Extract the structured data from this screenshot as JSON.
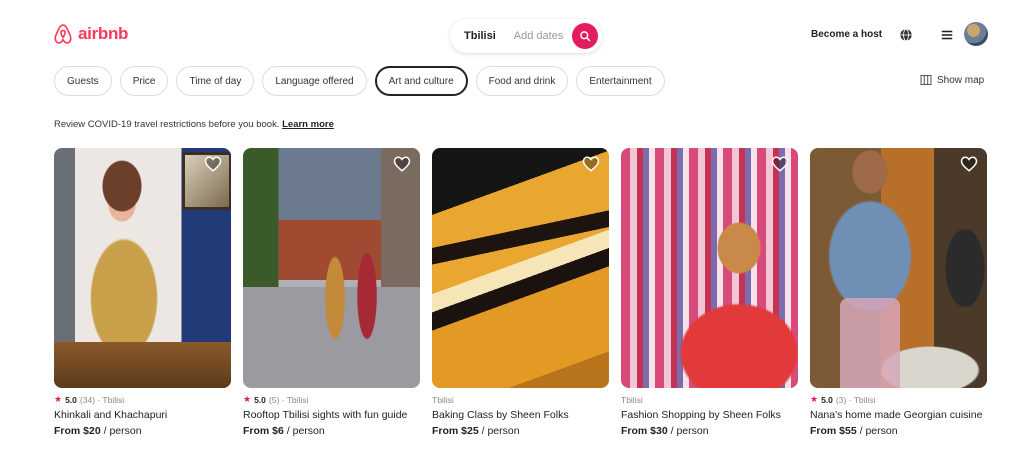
{
  "header": {
    "logo_text": "airbnb",
    "search": {
      "location": "Tbilisi",
      "guests": "Add dates"
    },
    "host_link": "Become a host"
  },
  "filters": {
    "chips": [
      {
        "label": "Guests",
        "active": false
      },
      {
        "label": "Price",
        "active": false
      },
      {
        "label": "Time of day",
        "active": false
      },
      {
        "label": "Language offered",
        "active": false
      },
      {
        "label": "Art and culture",
        "active": true
      },
      {
        "label": "Food and drink",
        "active": false
      },
      {
        "label": "Entertainment",
        "active": false
      }
    ],
    "show_map": "Show map"
  },
  "notice": {
    "text": "Review COVID-19 travel restrictions before you book.",
    "link": "Learn more"
  },
  "cards": [
    {
      "rating": "5.0",
      "meta": "(34) · Tbilisi",
      "title": "Khinkali and Khachapuri",
      "price": "From $20",
      "unit": " / person"
    },
    {
      "rating": "5.0",
      "meta": "(5) · Tbilisi",
      "title": "Rooftop Tbilisi sights with fun guide",
      "price": "From $6",
      "unit": " / person"
    },
    {
      "rating": "",
      "meta": "Tbilisi",
      "title": "Baking Class by Sheen Folks",
      "price": "From $25",
      "unit": " / person"
    },
    {
      "rating": "",
      "meta": "Tbilisi",
      "title": "Fashion Shopping by Sheen Folks",
      "price": "From $30",
      "unit": " / person"
    },
    {
      "rating": "5.0",
      "meta": "(3) · Tbilisi",
      "title": "Nana's home made Georgian cuisine",
      "price": "From $55",
      "unit": " / person"
    }
  ],
  "colors": {
    "brand": "#ff385c",
    "search_button": "#e31c5f"
  },
  "icons": [
    "airbnb-logo-icon",
    "search-icon",
    "globe-icon",
    "menu-icon",
    "map-icon",
    "heart-icon",
    "star-icon"
  ]
}
